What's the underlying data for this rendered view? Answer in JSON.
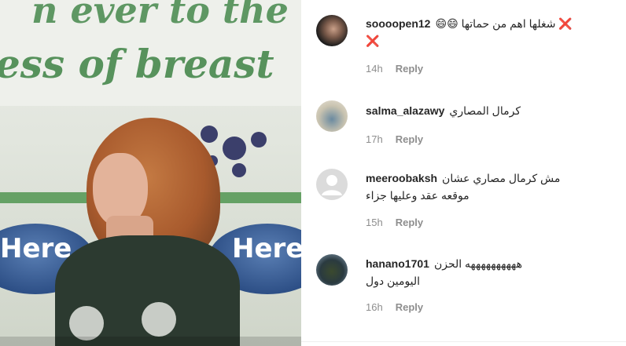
{
  "media": {
    "banner_line1": "n ever to the",
    "banner_line2": "ess of breast",
    "logo_text": "Here",
    "colors": {
      "banner_green": "#4f8e55",
      "logo_blue": "#2d4f86",
      "dress": "#2c3a30"
    }
  },
  "comments": [
    {
      "username": "soooopen12",
      "text_line1": "😄😄 شغلها اهم من حماتها ❌",
      "text_line2": "❌",
      "time": "14h",
      "reply": "Reply",
      "avatar_icon": "profile-photo-dark-hair"
    },
    {
      "username": "salma_alazawy",
      "text_line1": "كرمال المصاري",
      "text_line2": "",
      "time": "17h",
      "reply": "Reply",
      "avatar_icon": "profile-photo-figure"
    },
    {
      "username": "meeroobaksh",
      "text_line1": "مش كرمال مصاري عشان",
      "text_line2": "موقعه عقد وعليها جزاء",
      "time": "15h",
      "reply": "Reply",
      "avatar_icon": "default-avatar-icon"
    },
    {
      "username": "hanano1701",
      "text_line1": "ههههههههههه الحزن",
      "text_line2": "اليومين دول",
      "time": "16h",
      "reply": "Reply",
      "avatar_icon": "profile-photo-outdoor"
    }
  ],
  "colors": {
    "text": "#262626",
    "meta": "#8e8e8e"
  }
}
